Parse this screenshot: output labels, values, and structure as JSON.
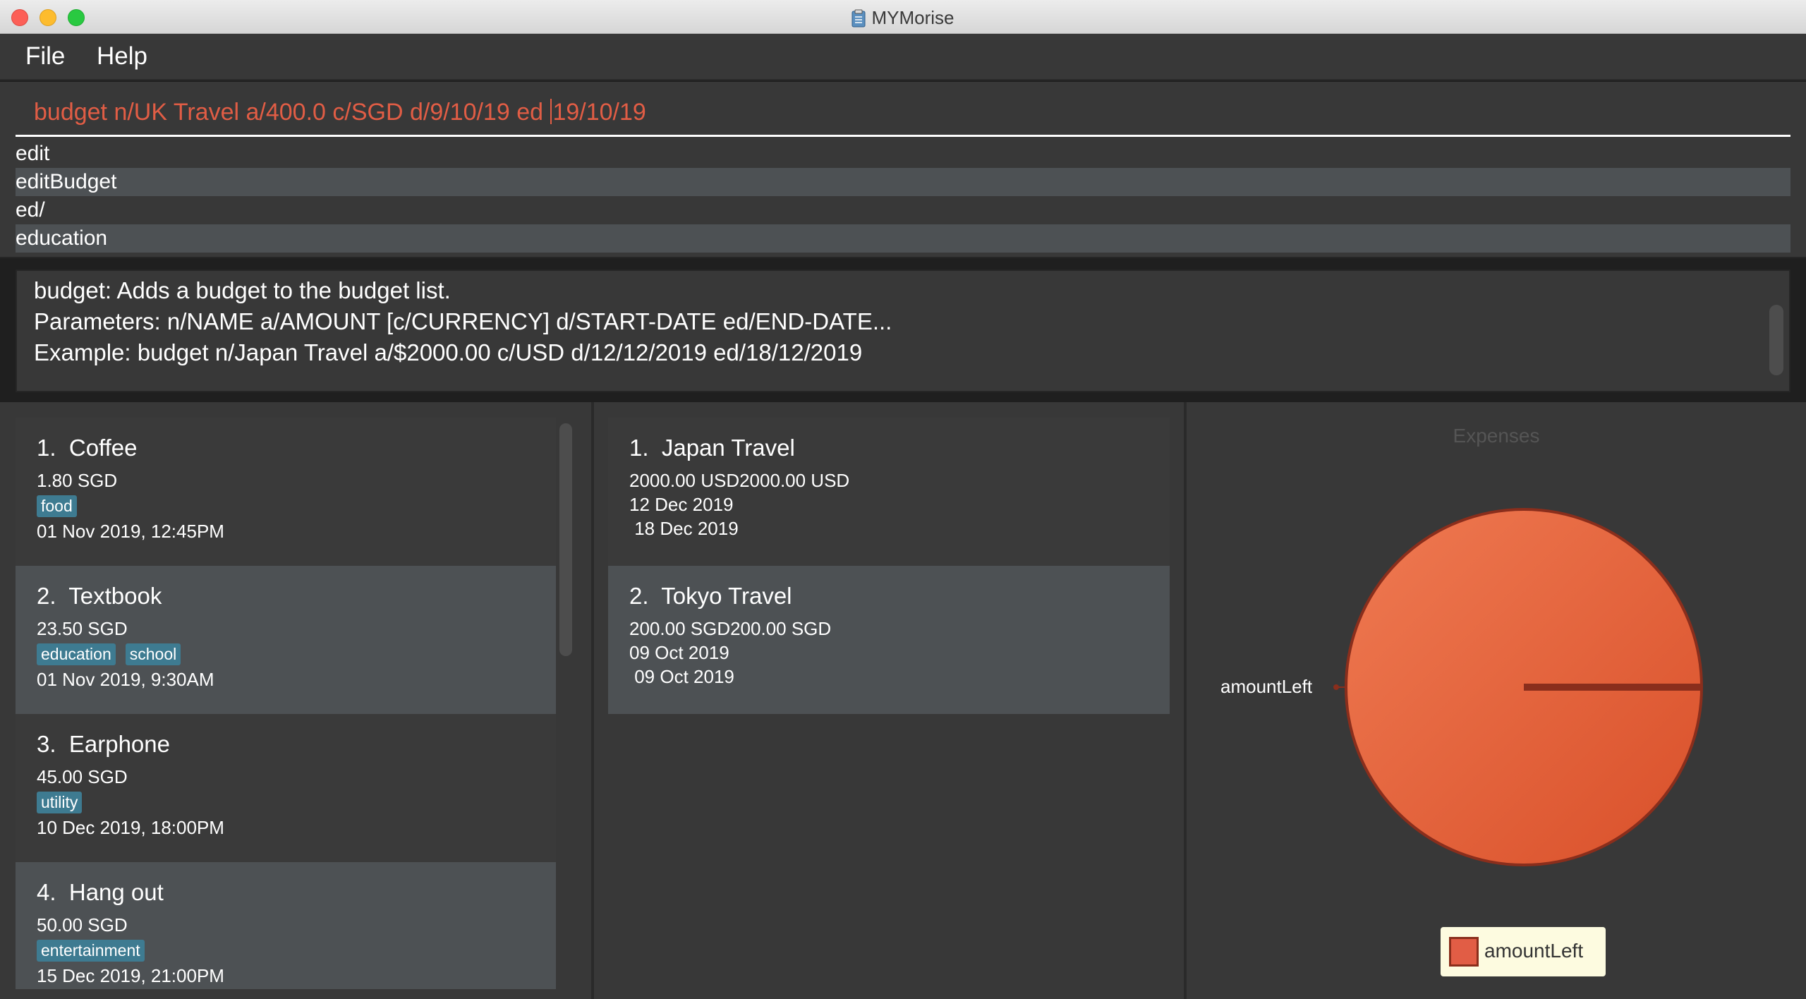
{
  "window": {
    "title": "MYMorise"
  },
  "menu": {
    "file": "File",
    "help": "Help"
  },
  "command": {
    "before_caret": "budget n/UK Travel a/400.0 c/SGD d/9/10/19 ed ",
    "after_caret": "19/10/19"
  },
  "suggestions": [
    "edit",
    "editBudget",
    "ed/",
    "education"
  ],
  "result": {
    "lines": [
      "budget: Adds a budget to the budget list.",
      "Parameters: n/NAME a/AMOUNT [c/CURRENCY] d/START-DATE ed/END-DATE...",
      "Example: budget n/Japan Travel a/$2000.00 c/USD d/12/12/2019 ed/18/12/2019"
    ]
  },
  "expenses": [
    {
      "title": "1.  Coffee",
      "amount": "1.80 SGD",
      "tags": [
        "food"
      ],
      "datetime": "01 Nov 2019, 12:45PM"
    },
    {
      "title": "2.  Textbook",
      "amount": "23.50 SGD",
      "tags": [
        "education",
        "school"
      ],
      "datetime": "01 Nov 2019, 9:30AM"
    },
    {
      "title": "3.  Earphone",
      "amount": "45.00 SGD",
      "tags": [
        "utility"
      ],
      "datetime": "10 Dec 2019, 18:00PM"
    },
    {
      "title": "4.  Hang out",
      "amount": "50.00 SGD",
      "tags": [
        "entertainment"
      ],
      "datetime": "15 Dec 2019, 21:00PM"
    }
  ],
  "budgets": [
    {
      "title": "1.  Japan Travel",
      "amount": "2000.00 USD2000.00 USD",
      "start": "12 Dec 2019",
      "end": " 18 Dec 2019"
    },
    {
      "title": "2.  Tokyo Travel",
      "amount": "200.00 SGD200.00 SGD",
      "start": "09 Oct 2019",
      "end": " 09 Oct 2019"
    }
  ],
  "colors": {
    "accent": "#e15d45",
    "tag": "#3e7b91",
    "pie_fill": "#e15d45",
    "pie_stroke": "#8a2e1c"
  },
  "chart_data": {
    "type": "pie",
    "title": "Expenses",
    "categories": [
      "amountLeft"
    ],
    "values": [
      100
    ],
    "legend": "bottom"
  }
}
